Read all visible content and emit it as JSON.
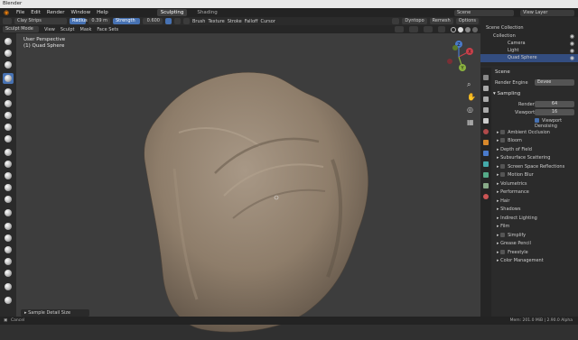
{
  "titlebar": {
    "title": "Blender"
  },
  "menubar": {
    "items": [
      "File",
      "Edit",
      "Render",
      "Window",
      "Help"
    ],
    "workspaces": [
      "Sculpting",
      "Shading"
    ],
    "active_workspace": "Sculpting",
    "scene": "Scene",
    "view_layer": "View Layer"
  },
  "toolheader": {
    "brush": "Clay Strips",
    "radius_label": "Radius",
    "radius_value": "0.39 m",
    "strength_label": "Strength",
    "strength_value": "0.600",
    "menus": [
      "Brush",
      "Texture",
      "Stroke",
      "Falloff",
      "Cursor"
    ],
    "dyntopo": "Dyntopo",
    "remesh": "Remesh",
    "options": "Options"
  },
  "viewheader": {
    "mode": "Sculpt Mode",
    "items": [
      "View",
      "Sculpt",
      "Mask",
      "Face Sets"
    ]
  },
  "viewport": {
    "line1": "User Perspective",
    "line2": "(1) Quad Sphere",
    "axes": {
      "x": "X",
      "y": "Y",
      "z": "Z"
    },
    "sample_detail": "Sample Detail Size"
  },
  "outliner": {
    "root": "Scene Collection",
    "items": [
      {
        "label": "Collection"
      },
      {
        "label": "Camera"
      },
      {
        "label": "Light"
      },
      {
        "label": "Quad Sphere"
      }
    ]
  },
  "properties": {
    "header": "Scene",
    "render_engine_label": "Render Engine",
    "render_engine": "Eevee",
    "sampling": "Sampling",
    "render_label": "Render",
    "render_value": "64",
    "viewport_label": "Viewport",
    "viewport_value": "16",
    "viewport_denoising": "Viewport Denoising",
    "sections": [
      "Ambient Occlusion",
      "Bloom",
      "Depth of Field",
      "Subsurface Scattering",
      "Screen Space Reflections",
      "Motion Blur",
      "Volumetrics",
      "Performance",
      "Hair",
      "Shadows",
      "Indirect Lighting",
      "Film",
      "Simplify",
      "Grease Pencil",
      "Freestyle",
      "Color Management"
    ]
  },
  "statusbar": {
    "left": "Cancel",
    "right": "Mem: 201.0 MiB | 2.90.0 Alpha"
  }
}
